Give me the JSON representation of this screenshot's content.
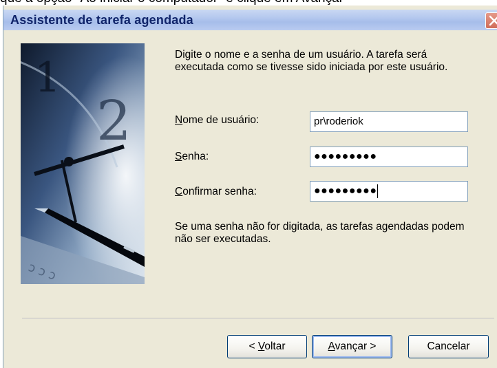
{
  "background_text": "que a opção \"Ao iniciar o computador\" e clique em Avançar",
  "window": {
    "title": "Assistente de tarefa agendada"
  },
  "intro_text": "Digite o nome e a senha de um usuário. A tarefa será executada como se tivesse sido iniciada por este usuário.",
  "fields": {
    "username": {
      "label_first": "N",
      "label_rest": "ome de usuário:",
      "value": "pr\\roderiok"
    },
    "password": {
      "label_first": "S",
      "label_rest": "enha:",
      "value": "●●●●●●●●●"
    },
    "confirm": {
      "label_first": "C",
      "label_rest": "onfirmar senha:",
      "value": "●●●●●●●●●"
    }
  },
  "note_text": "Se uma senha não for digitada, as tarefas agendadas podem não ser executadas.",
  "buttons": {
    "back": {
      "prefix": "< ",
      "mnemonic": "V",
      "rest": "oltar"
    },
    "next": {
      "mnemonic": "A",
      "rest": "vançar >"
    },
    "cancel": {
      "label": "Cancelar"
    }
  },
  "colors": {
    "dialog_bg": "#ece9d8",
    "titlebar": "#b4c8ee",
    "title_text": "#10246a",
    "field_border": "#7f9db9"
  }
}
